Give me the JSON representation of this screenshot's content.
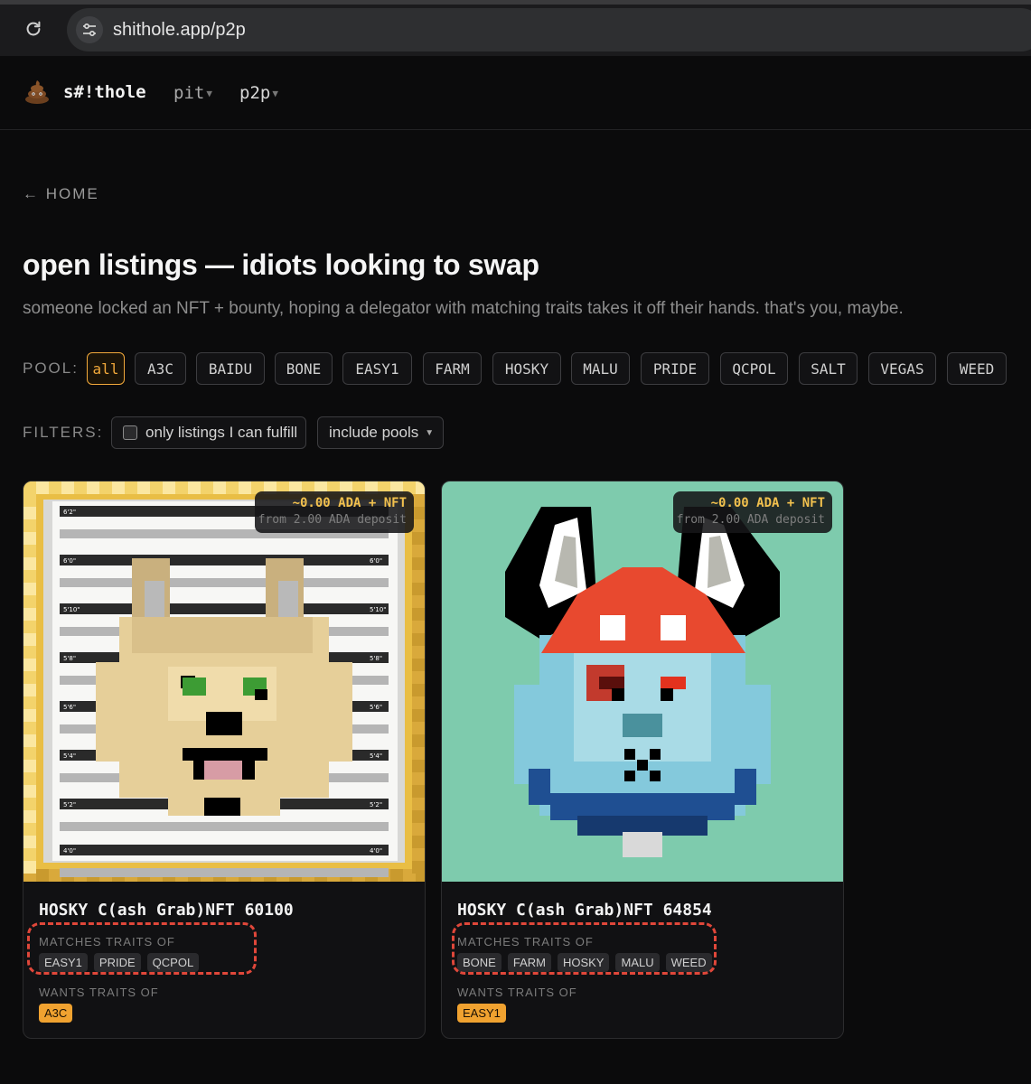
{
  "browser": {
    "url": "shithole.app/p2p"
  },
  "nav": {
    "brand": "s#!thole",
    "links": [
      {
        "label": "pit"
      },
      {
        "label": "p2p"
      }
    ]
  },
  "back_label": "← HOME",
  "page": {
    "title": "open listings — idiots looking to swap",
    "subtitle": "someone locked an NFT + bounty, hoping a delegator with matching traits takes it off their hands. that's you, maybe."
  },
  "pool": {
    "label": "POOL:",
    "chips": [
      "all",
      "A3C",
      "BAIDU",
      "BONE",
      "EASY1",
      "FARM",
      "HOSKY",
      "MALU",
      "PRIDE",
      "QCPOL",
      "SALT",
      "VEGAS",
      "WEED"
    ],
    "selected": "all"
  },
  "filters": {
    "label": "FILTERS:",
    "fulfill_label": "only listings I can fulfill",
    "fulfill_checked": false,
    "pools_label": "include pools"
  },
  "listings": [
    {
      "amount": "~0.00 ADA + NFT",
      "deposit": "from 2.00 ADA deposit",
      "name": "HOSKY C(ash Grab)NFT 60100",
      "matches_label": "MATCHES TRAITS OF",
      "matches": [
        "EASY1",
        "PRIDE",
        "QCPOL"
      ],
      "wants_label": "WANTS TRAITS OF",
      "wants": [
        "A3C"
      ],
      "image": {
        "heights": [
          "6'2\"",
          "6'0\"",
          "5'10\"",
          "5'8\"",
          "5'6\"",
          "5'4\"",
          "5'2\"",
          "4'0\""
        ]
      }
    },
    {
      "amount": "~0.00 ADA + NFT",
      "deposit": "from 2.00 ADA deposit",
      "name": "HOSKY C(ash Grab)NFT 64854",
      "matches_label": "MATCHES TRAITS OF",
      "matches": [
        "BONE",
        "FARM",
        "HOSKY",
        "MALU",
        "WEED"
      ],
      "wants_label": "WANTS TRAITS OF",
      "wants": [
        "EASY1"
      ]
    }
  ],
  "colors": {
    "accent": "#f2a93b",
    "want_tag": "#f0a230",
    "highlight": "#e0473a",
    "card2_bg": "#7ecbad"
  }
}
